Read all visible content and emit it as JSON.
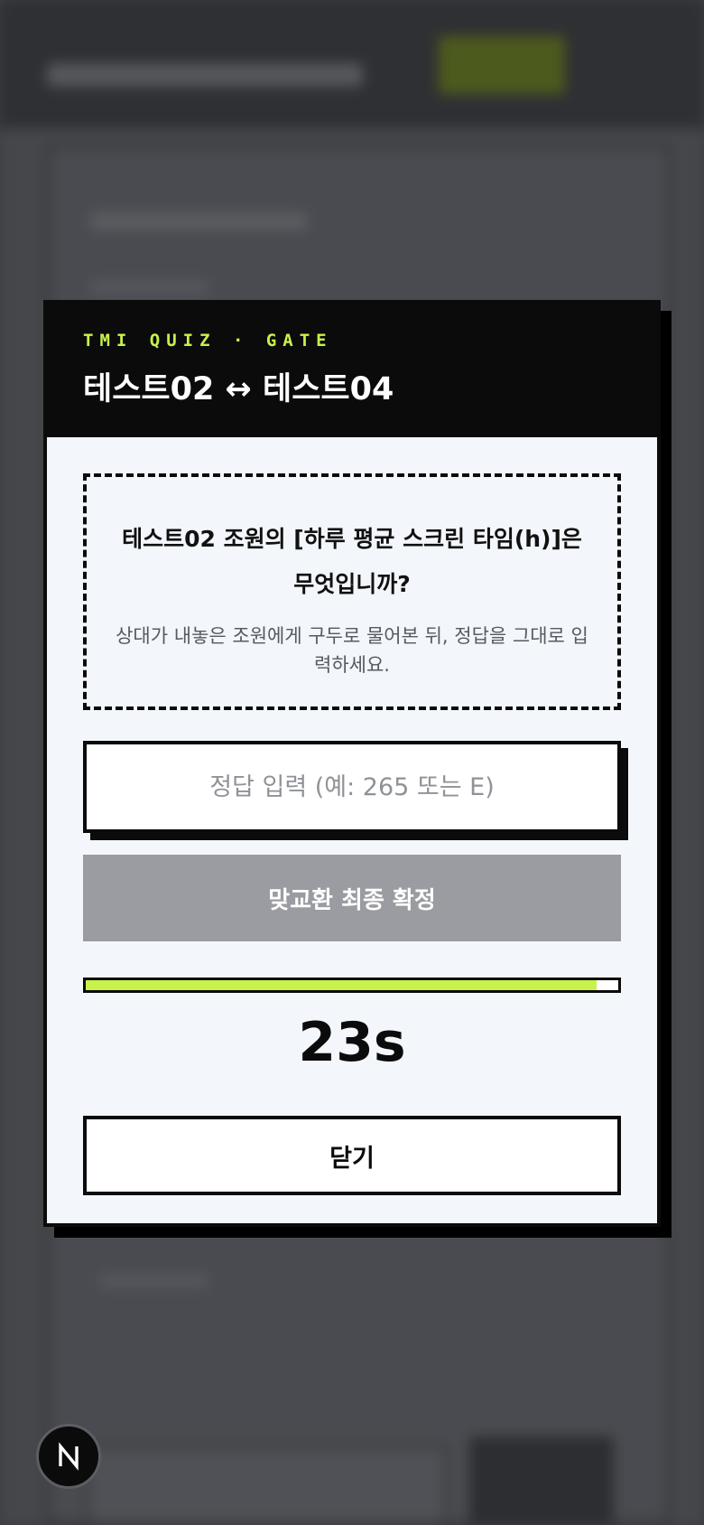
{
  "modal": {
    "eyebrow": "TMI QUIZ · GATE",
    "title": "테스트02 ↔ 테스트04",
    "question": "테스트02 조원의 [하루 평균 스크린 타임(h)]은 무엇입니까?",
    "hint": "상대가 내놓은 조원에게 구두로 물어본 뒤, 정답을 그대로 입력하세요.",
    "answer_placeholder": "정답 입력 (예: 265 또는 E)",
    "answer_value": "",
    "confirm_label": "맞교환 최종 확정",
    "progress_fraction": 0.96,
    "timer": "23s",
    "close_label": "닫기"
  },
  "badge": {
    "icon": "next-logo-icon"
  },
  "colors": {
    "accent": "#c8f24a",
    "header_bg": "#0b0b0c",
    "body_bg": "#f3f6fb",
    "disabled_button": "#9b9ca1",
    "overlay": "#3c3d40"
  }
}
